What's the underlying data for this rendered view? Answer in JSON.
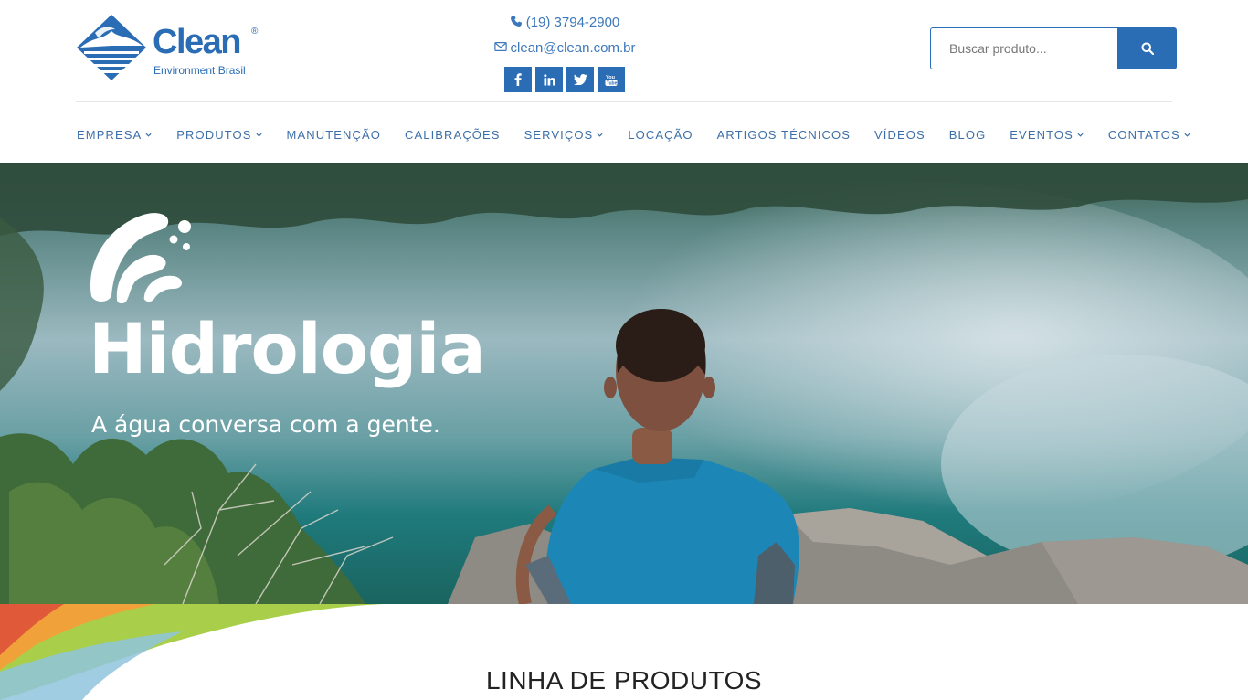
{
  "brand": {
    "name": "Clean",
    "registered": "®",
    "tagline": "Environment Brasil",
    "logo_icon": "clean-logo-diamond-icon",
    "primary_color": "#2a6db5"
  },
  "contact": {
    "phone": "(19) 3794-2900",
    "email": "clean@clean.com.br"
  },
  "socials": [
    {
      "name": "facebook",
      "icon": "facebook-icon"
    },
    {
      "name": "linkedin",
      "icon": "linkedin-icon"
    },
    {
      "name": "twitter",
      "icon": "twitter-icon"
    },
    {
      "name": "youtube",
      "icon": "youtube-icon"
    }
  ],
  "search": {
    "placeholder": "Buscar produto...",
    "icon": "search-icon"
  },
  "nav": [
    {
      "label": "EMPRESA",
      "dropdown": true
    },
    {
      "label": "PRODUTOS",
      "dropdown": true
    },
    {
      "label": "MANUTENÇÃO",
      "dropdown": false
    },
    {
      "label": "CALIBRAÇÕES",
      "dropdown": false
    },
    {
      "label": "SERVIÇOS",
      "dropdown": true
    },
    {
      "label": "LOCAÇÃO",
      "dropdown": false
    },
    {
      "label": "ARTIGOS TÉCNICOS",
      "dropdown": false
    },
    {
      "label": "VÍDEOS",
      "dropdown": false
    },
    {
      "label": "BLOG",
      "dropdown": false
    },
    {
      "label": "EVENTOS",
      "dropdown": true
    },
    {
      "label": "CONTATOS",
      "dropdown": true
    }
  ],
  "hero": {
    "title": "Hidrologia",
    "subtitle": "A água conversa com a gente.",
    "icon": "water-splash-icon"
  },
  "section": {
    "title": "LINHA DE PRODUTOS"
  }
}
